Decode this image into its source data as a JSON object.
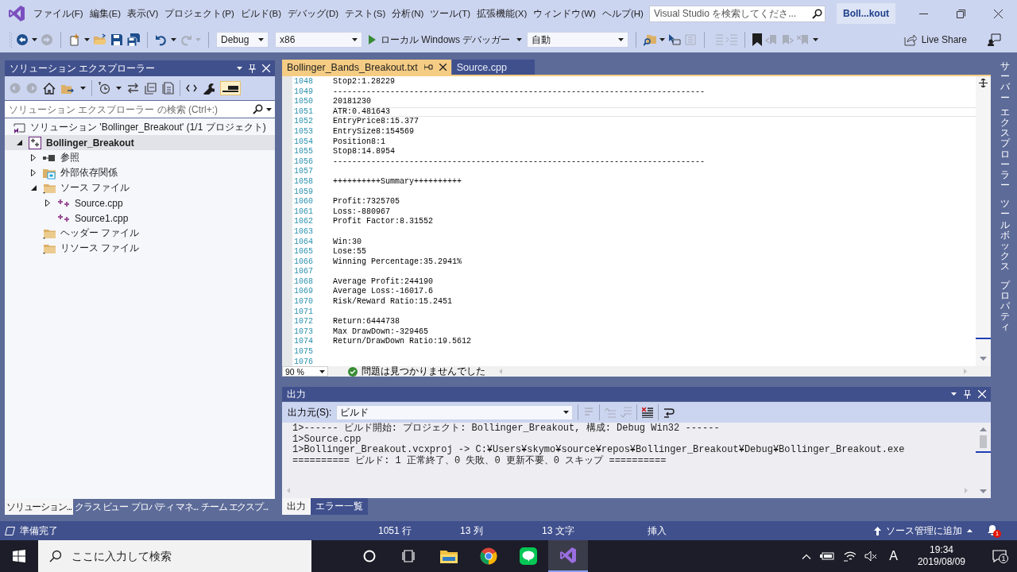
{
  "menu_bar": {
    "items": [
      "ファイル(F)",
      "編集(E)",
      "表示(V)",
      "プロジェクト(P)",
      "ビルド(B)",
      "デバッグ(D)",
      "テスト(S)",
      "分析(N)",
      "ツール(T)",
      "拡張機能(X)",
      "ウィンドウ(W)",
      "ヘルプ(H)"
    ],
    "search": {
      "placeholder": "Visual Studio を検索してくださ..."
    },
    "solution_name": "Boll...kout"
  },
  "toolbar": {
    "configuration": "Debug",
    "platform": "x86",
    "start_button": "ローカル Windows デバッガー",
    "debug_target": "自動",
    "live_share": "Live Share"
  },
  "solution_explorer": {
    "title": "ソリューション エクスプローラー",
    "search": {
      "placeholder": "ソリューション エクスプローラー の検索 (Ctrl+:)"
    },
    "tree": [
      {
        "label": "ソリューション 'Bollinger_Breakout' (1/1 プロジェクト)",
        "kind": "solution",
        "selected": false,
        "children": [
          {
            "label": "Bollinger_Breakout",
            "kind": "project",
            "selected": true,
            "expanded": true,
            "children": [
              {
                "label": "参照",
                "kind": "references",
                "selected": false,
                "expanded": false
              },
              {
                "label": "外部依存関係",
                "kind": "external",
                "selected": false,
                "expanded": false
              },
              {
                "label": "ソース ファイル",
                "kind": "folder",
                "selected": false,
                "expanded": true,
                "children": [
                  {
                    "label": "Source.cpp",
                    "kind": "cpp",
                    "selected": false,
                    "expanded": false
                  },
                  {
                    "label": "Source1.cpp",
                    "kind": "cpp",
                    "selected": false
                  }
                ]
              },
              {
                "label": "ヘッダー ファイル",
                "kind": "folder",
                "selected": false
              },
              {
                "label": "リソース ファイル",
                "kind": "folder",
                "selected": false
              }
            ]
          }
        ]
      }
    ],
    "tabs": [
      {
        "label": "ソリューション...",
        "selected": true
      },
      {
        "label": "クラス ビュー",
        "selected": false
      },
      {
        "label": "プロパティ マネ...",
        "selected": false
      },
      {
        "label": "チーム エクスプ...",
        "selected": false
      }
    ]
  },
  "editor": {
    "tabs": [
      {
        "label": "Bollinger_Bands_Breakout.txt",
        "selected": true
      },
      {
        "label": "Source.cpp",
        "selected": false
      }
    ],
    "lines": [
      {
        "number": "1048",
        "text": "Stop2:1.28229",
        "current": false
      },
      {
        "number": "1049",
        "text": "------------------------------------------------------------------------------",
        "current": false
      },
      {
        "number": "1050",
        "text": "20181230",
        "current": false
      },
      {
        "number": "1051",
        "text": "ATR:0.481643",
        "current": true
      },
      {
        "number": "1052",
        "text": "EntryPrice8:15.377",
        "current": false
      },
      {
        "number": "1053",
        "text": "EntrySize8:154569",
        "current": false
      },
      {
        "number": "1054",
        "text": "Position8:1",
        "current": false
      },
      {
        "number": "1055",
        "text": "Stop8:14.8954",
        "current": false
      },
      {
        "number": "1056",
        "text": "------------------------------------------------------------------------------",
        "current": false
      },
      {
        "number": "1057",
        "current": false
      },
      {
        "number": "1058",
        "text": "++++++++++Summary++++++++++",
        "current": false
      },
      {
        "number": "1059",
        "current": false
      },
      {
        "number": "1060",
        "text": "Profit:7325705",
        "current": false
      },
      {
        "number": "1061",
        "text": "Loss:-880967",
        "current": false
      },
      {
        "number": "1062",
        "text": "Profit Factor:8.31552",
        "current": false
      },
      {
        "number": "1063",
        "current": false
      },
      {
        "number": "1064",
        "text": "Win:30",
        "current": false
      },
      {
        "number": "1065",
        "text": "Lose:55",
        "current": false
      },
      {
        "number": "1066",
        "text": "Winning Percentage:35.2941%",
        "current": false
      },
      {
        "number": "1067",
        "current": false
      },
      {
        "number": "1068",
        "text": "Average Profit:244190",
        "current": false
      },
      {
        "number": "1069",
        "text": "Average Loss:-16017.6",
        "current": false
      },
      {
        "number": "1070",
        "text": "Risk/Reward Ratio:15.2451",
        "current": false
      },
      {
        "number": "1071",
        "current": false
      },
      {
        "number": "1072",
        "text": "Return:6444738",
        "current": false
      },
      {
        "number": "1073",
        "text": "Max DrawDown:-329465",
        "current": false
      },
      {
        "number": "1074",
        "text": "Return/DrawDown Ratio:19.5612",
        "current": false
      },
      {
        "number": "1075",
        "current": false
      },
      {
        "number": "1076",
        "current": false
      }
    ],
    "zoom": "90 %",
    "issues": "問題は見つかりませんでした"
  },
  "output": {
    "title": "出力",
    "source_label": "出力元(S):",
    "source": "ビルド",
    "lines": [
      "1>------ ビルド開始: プロジェクト: Bollinger_Breakout, 構成: Debug Win32 ------",
      "1>Source.cpp",
      "1>Bollinger_Breakout.vcxproj -> C:¥Users¥skymo¥source¥repos¥Bollinger_Breakout¥Debug¥Bollinger_Breakout.exe",
      "========== ビルド: 1 正常終了、0 失敗、0 更新不要、0 スキップ =========="
    ],
    "tabs": [
      {
        "label": "出力",
        "selected": true
      },
      {
        "label": "エラー一覧",
        "selected": false
      }
    ]
  },
  "side_tabs": [
    {
      "words": [
        "サーバー",
        "エクスプローラー"
      ]
    },
    {
      "words": [
        "ツールボックス"
      ]
    },
    {
      "words": [
        "プロパティ"
      ]
    }
  ],
  "status_bar": {
    "state": "準備完了",
    "line": "1051 行",
    "column": "13 列",
    "characters": "13 文字",
    "mode": "挿入",
    "source_control": "ソース管理に追加",
    "notifications": "1"
  },
  "taskbar": {
    "search": {
      "placeholder": "ここに入力して検索"
    },
    "ime": "A",
    "time": "19:34",
    "date": "2019/08/09",
    "notifications": "1"
  }
}
